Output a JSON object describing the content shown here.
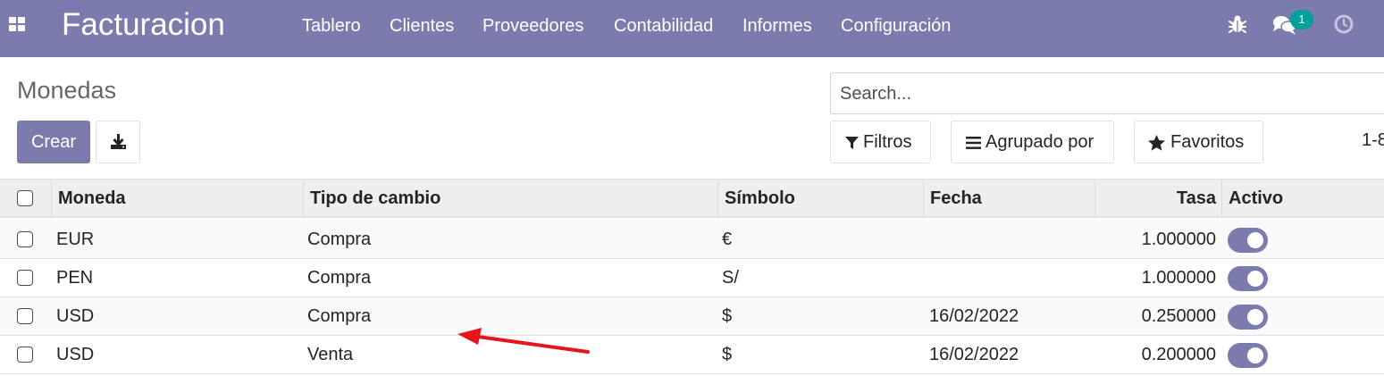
{
  "navbar": {
    "app_title": "Facturacion",
    "menu": [
      "Tablero",
      "Clientes",
      "Proveedores",
      "Contabilidad",
      "Informes",
      "Configuración"
    ],
    "messages_badge": "1",
    "icons": [
      "apps-grid-icon",
      "bug-icon",
      "chat-icon",
      "clock-icon"
    ]
  },
  "control_panel": {
    "breadcrumb": "Monedas",
    "create_label": "Crear",
    "download_icon": "download-icon",
    "search_placeholder": "Search...",
    "filters_label": "Filtros",
    "groupby_label": "Agrupado por",
    "favorites_label": "Favoritos",
    "pager_text": "1-8"
  },
  "table": {
    "headers": [
      "Moneda",
      "Tipo de cambio",
      "Símbolo",
      "Fecha",
      "Tasa",
      "Activo"
    ],
    "rows": [
      {
        "moneda": "EUR",
        "tipo": "Compra",
        "simbolo": "€",
        "fecha": "",
        "tasa": "1.000000",
        "activo": true
      },
      {
        "moneda": "PEN",
        "tipo": "Compra",
        "simbolo": "S/",
        "fecha": "",
        "tasa": "1.000000",
        "activo": true
      },
      {
        "moneda": "USD",
        "tipo": "Compra",
        "simbolo": "$",
        "fecha": "16/02/2022",
        "tasa": "0.250000",
        "activo": true
      },
      {
        "moneda": "USD",
        "tipo": "Venta",
        "simbolo": "$",
        "fecha": "16/02/2022",
        "tasa": "0.200000",
        "activo": true
      }
    ]
  },
  "colors": {
    "brand": "#7c7bad",
    "badge": "#00a09d",
    "annotation_arrow": "#e8141c"
  }
}
